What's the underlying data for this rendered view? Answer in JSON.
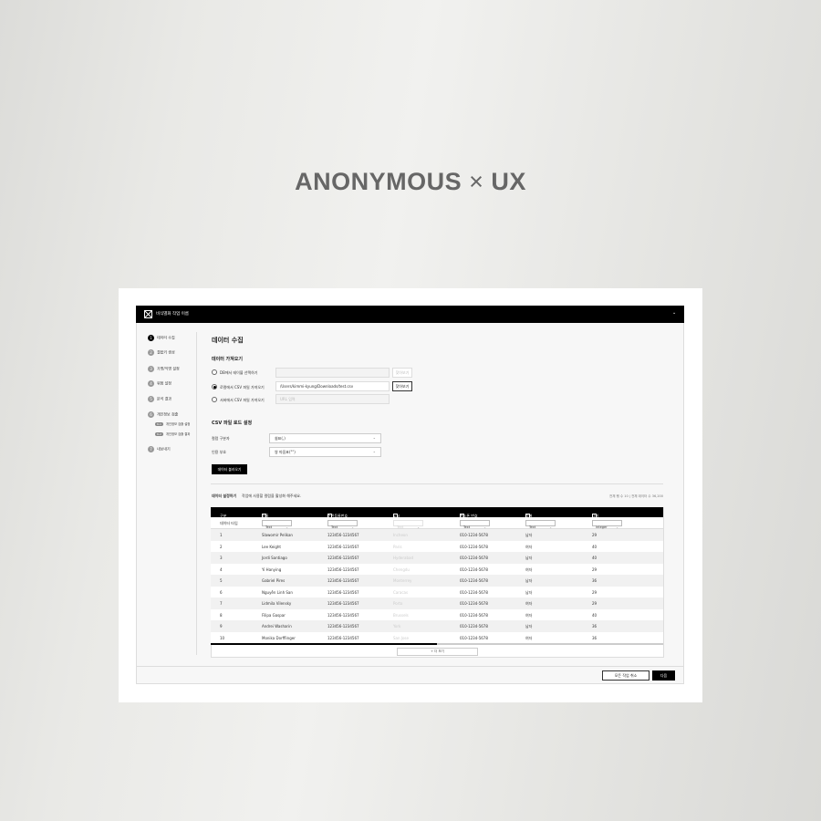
{
  "brand": {
    "left": "ANONYMOUS",
    "sep": "×",
    "right": "UX"
  },
  "header": {
    "title": "비식별화 작업 이름",
    "chevron": "chevron-down-icon"
  },
  "sidebar": {
    "items": [
      {
        "num": "1",
        "label": "데이터 수집",
        "active": true
      },
      {
        "num": "2",
        "label": "결합키 생성"
      },
      {
        "num": "3",
        "label": "가명/익명 설정"
      },
      {
        "num": "4",
        "label": "위험 설정"
      },
      {
        "num": "5",
        "label": "분석 결과"
      },
      {
        "num": "6",
        "label": "개인정보 검출",
        "subs": [
          {
            "tag": "6-1",
            "label": "개인정보 검출 설정"
          },
          {
            "tag": "6-2",
            "label": "개인정보 검출 결과"
          }
        ]
      },
      {
        "num": "7",
        "label": "내보내기"
      }
    ]
  },
  "main": {
    "title": "데이터 수집",
    "import": {
      "heading": "데이터 가져오기",
      "options": [
        {
          "label": "DB에서 테이블 선택하기",
          "value": "",
          "button": "찾아보기",
          "selected": false
        },
        {
          "label": "로컬에서 CSV 파일 가져오기",
          "value": "/Users/kimmi-kyung/Downloads/test.csv",
          "button": "찾아보기",
          "selected": true
        },
        {
          "label": "서버에서 CSV 파일 가져오기",
          "placeholder": "URL 입력",
          "selected": false
        }
      ]
    },
    "csv": {
      "heading": "CSV 파일 로드 설정",
      "fields": [
        {
          "label": "컬럼 구분자",
          "value": "쉼표(,)"
        },
        {
          "label": "인용 부호",
          "value": "쌍 따옴표(\"\")"
        }
      ],
      "load_button": "데이터 불러오기"
    },
    "settings": {
      "heading": "데이터 설정하기",
      "hint": "작업에 사용할 컬럼을 활성화 해주세요.",
      "stats": "전체 행 수 10  |  전체 데이터 수 36,200"
    },
    "table": {
      "columns": [
        {
          "label": "구분"
        },
        {
          "label": "이름",
          "enabled": true
        },
        {
          "label": "주민등록번호",
          "enabled": true
        },
        {
          "label": "도시",
          "enabled": false
        },
        {
          "label": "핸드폰 번호",
          "enabled": true
        },
        {
          "label": "성별",
          "enabled": true
        },
        {
          "label": "나이",
          "enabled": true
        }
      ],
      "type_label": "데이터 타입",
      "types": [
        "Text",
        "Text",
        "Text",
        "Text",
        "Text",
        "integer"
      ],
      "rows": [
        [
          "1",
          "Slawomir Pelikan",
          "123456-1234567",
          "Incheon",
          "010-1234-5678",
          "남자",
          "29"
        ],
        [
          "2",
          "Lee Keight",
          "123456-1234567",
          "Paris",
          "010-1234-5678",
          "여자",
          "40"
        ],
        [
          "3",
          "Jordi Santiago",
          "123456-1234567",
          "Hyderabad",
          "010-1234-5678",
          "남자",
          "40"
        ],
        [
          "4",
          "Yi Hanying",
          "123456-1234567",
          "Chengdu",
          "010-1234-5678",
          "여자",
          "29"
        ],
        [
          "5",
          "Gabriel Pires",
          "123456-1234567",
          "Monterrey",
          "010-1234-5678",
          "남자",
          "36"
        ],
        [
          "6",
          "Nguyễn Linh San",
          "123456-1234567",
          "Caracas",
          "010-1234-5678",
          "남자",
          "29"
        ],
        [
          "7",
          "Lidmila Vilensky",
          "123456-1234567",
          "Porto",
          "010-1234-5678",
          "여자",
          "29"
        ],
        [
          "8",
          "Filipa Gaspar",
          "123456-1234567",
          "Brussels",
          "010-1234-5678",
          "여자",
          "40"
        ],
        [
          "9",
          "Andrei Washarin",
          "123456-1234567",
          "York",
          "010-1234-5678",
          "남자",
          "36"
        ],
        [
          "10",
          "Monika Dorfflinger",
          "123456-1234567",
          "San Jose",
          "010-1234-5678",
          "여자",
          "36"
        ]
      ],
      "more_button": "+ 더 보기",
      "scroll_fraction": 0.5
    }
  },
  "footer": {
    "cancel": "모든 작업 취소",
    "next": "다음"
  }
}
